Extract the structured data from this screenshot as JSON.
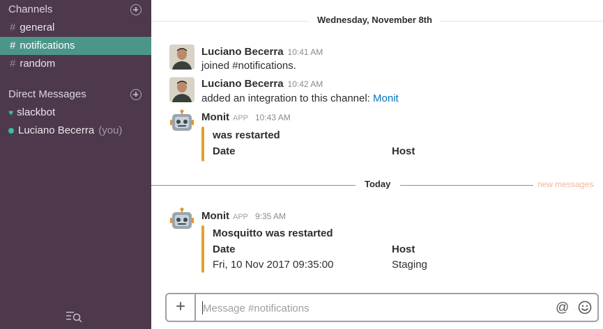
{
  "sidebar": {
    "channels_header": "Channels",
    "channels": [
      {
        "hash": "#",
        "name": "general"
      },
      {
        "hash": "#",
        "name": "notifications"
      },
      {
        "hash": "#",
        "name": "random"
      }
    ],
    "dm_header": "Direct Messages",
    "dms": [
      {
        "name": "slackbot"
      },
      {
        "name": "Luciano Becerra",
        "suffix": "(you)"
      }
    ]
  },
  "dividers": {
    "past_date": "Wednesday, November 8th",
    "today": "Today",
    "new_messages": "new messages"
  },
  "messages": [
    {
      "sender": "Luciano Becerra",
      "time": "10:41 AM",
      "text": "joined #notifications."
    },
    {
      "sender": "Luciano Becerra",
      "time": "10:42 AM",
      "text": "added an integration to this channel: ",
      "link": "Monit"
    },
    {
      "sender": "Monit",
      "badge": "APP",
      "time": "10:43 AM",
      "attachment": {
        "title": "was restarted",
        "field1_label": "Date",
        "field2_label": "Host"
      }
    },
    {
      "sender": "Monit",
      "badge": "APP",
      "time": "9:35 AM",
      "attachment": {
        "title": "Mosquitto was restarted",
        "field1_label": "Date",
        "field1_value": "Fri, 10 Nov 2017 09:35:00",
        "field2_label": "Host",
        "field2_value": "Staging"
      }
    }
  ],
  "composer": {
    "plus": "+",
    "placeholder": "Message #notifications",
    "at": "@"
  },
  "colors": {
    "sidebar_bg": "#4d394b",
    "active_channel": "#4c9689",
    "link": "#0576b9",
    "attachment_bar": "#e0a32d",
    "today_line": "#e8703a"
  }
}
